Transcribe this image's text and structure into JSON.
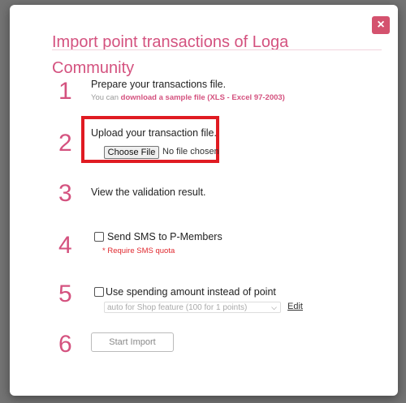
{
  "modal": {
    "title": "Import point transactions of Loga Community",
    "close_label": "×"
  },
  "steps": [
    {
      "number": "1",
      "text": "Prepare your transactions file.",
      "sub_prefix": "You can ",
      "sub_link": "download a sample file (XLS - Excel 97-2003)"
    },
    {
      "number": "2",
      "text": "Upload your transaction file.",
      "file_button": "Choose File",
      "file_status": "No file chosen"
    },
    {
      "number": "3",
      "text": "View the validation result."
    },
    {
      "number": "4",
      "checkbox_label": "Send SMS to P-Members",
      "warning": "* Require SMS quota"
    },
    {
      "number": "5",
      "checkbox_label": "Use spending amount instead of point",
      "select_value": "auto for Shop feature (100 for 1 points)",
      "edit_label": "Edit"
    },
    {
      "number": "6",
      "button": "Start Import"
    }
  ]
}
